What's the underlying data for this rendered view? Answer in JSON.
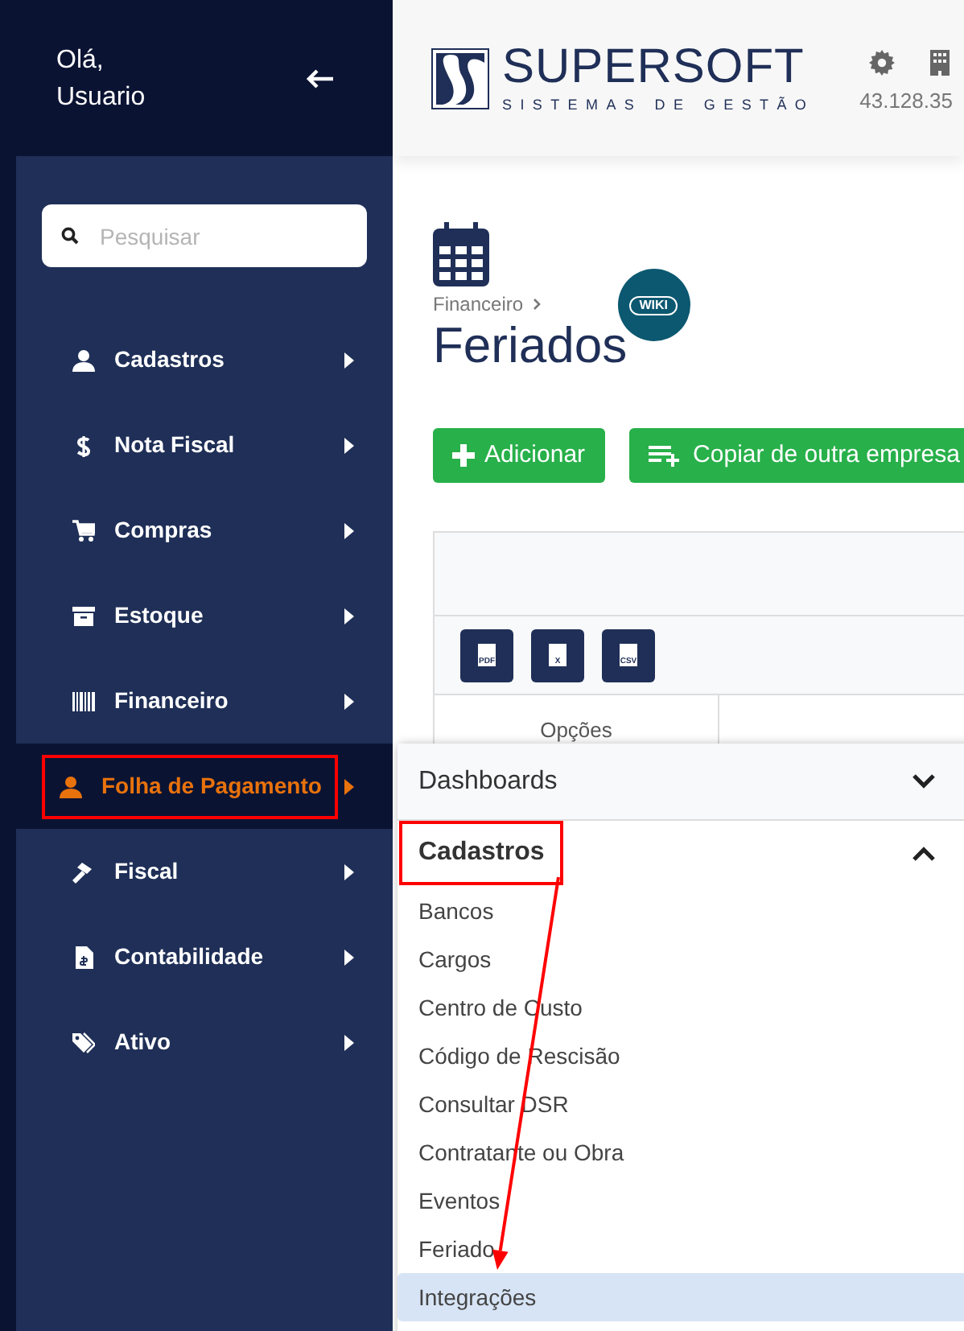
{
  "sidebar": {
    "greeting": [
      "Olá,",
      "Usuario"
    ],
    "search": {
      "placeholder": "Pesquisar"
    },
    "items": [
      {
        "label": "Cadastros",
        "selected": false,
        "highlighted": false
      },
      {
        "label": "Nota Fiscal",
        "selected": false,
        "highlighted": false
      },
      {
        "label": "Compras",
        "selected": false,
        "highlighted": false
      },
      {
        "label": "Estoque",
        "selected": false,
        "highlighted": false
      },
      {
        "label": "Financeiro",
        "selected": false,
        "highlighted": false
      },
      {
        "label": "Folha de Pagamento",
        "selected": true,
        "highlighted": true
      },
      {
        "label": "Fiscal",
        "selected": false,
        "highlighted": false
      },
      {
        "label": "Contabilidade",
        "selected": false,
        "highlighted": false
      },
      {
        "label": "Ativo",
        "selected": false,
        "highlighted": false
      }
    ]
  },
  "header": {
    "brand": "SUPERSOFT",
    "tagline": "SISTEMAS DE GESTÃO",
    "account": "43.128.35"
  },
  "page": {
    "breadcrumb": "Financeiro",
    "title": "Feriados",
    "wiki_badge": "WIKI",
    "buttons": [
      {
        "label": "Adicionar",
        "kind": "add"
      },
      {
        "label": "Copiar de outra empresa",
        "kind": "copy"
      }
    ],
    "exports": [
      "PDF",
      "X",
      "CSV"
    ],
    "table": {
      "columns": [
        "Opções"
      ]
    }
  },
  "flyout": {
    "sections": [
      {
        "title": "Dashboards",
        "expanded": false,
        "highlighted": false
      },
      {
        "title": "Cadastros",
        "expanded": true,
        "highlighted": true,
        "items": [
          {
            "label": "Bancos",
            "selected": false
          },
          {
            "label": "Cargos",
            "selected": false
          },
          {
            "label": "Centro de Custo",
            "selected": false
          },
          {
            "label": "Código de Rescisão",
            "selected": false
          },
          {
            "label": "Consultar DSR",
            "selected": false
          },
          {
            "label": "Contratante ou Obra",
            "selected": false
          },
          {
            "label": "Eventos",
            "selected": false
          },
          {
            "label": "Feriado",
            "selected": false
          },
          {
            "label": "Integrações",
            "selected": true
          }
        ]
      }
    ]
  }
}
